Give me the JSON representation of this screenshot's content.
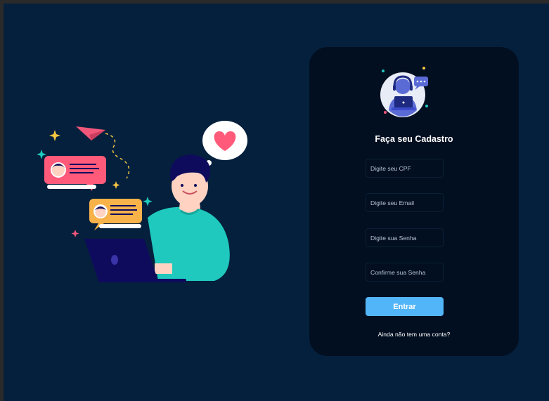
{
  "form": {
    "title": "Faça seu Cadastro",
    "cpf_placeholder": "Digite seu CPF",
    "email_placeholder": "Digite seu Email",
    "password_placeholder": "Digite sua Senha",
    "confirm_placeholder": "Confirme sua Senha",
    "submit_label": "Entrar",
    "signup_link": "Ainda não tem uma conta?"
  },
  "colors": {
    "background": "#04203d",
    "card": "#020f21",
    "button": "#52b5f7",
    "shirt": "#1fc9bd",
    "laptop": "#0f0b5c"
  },
  "icons": [
    "heart-icon",
    "paper-plane-icon",
    "chat-bubble-icon",
    "sparkle-icon",
    "support-agent-icon"
  ]
}
